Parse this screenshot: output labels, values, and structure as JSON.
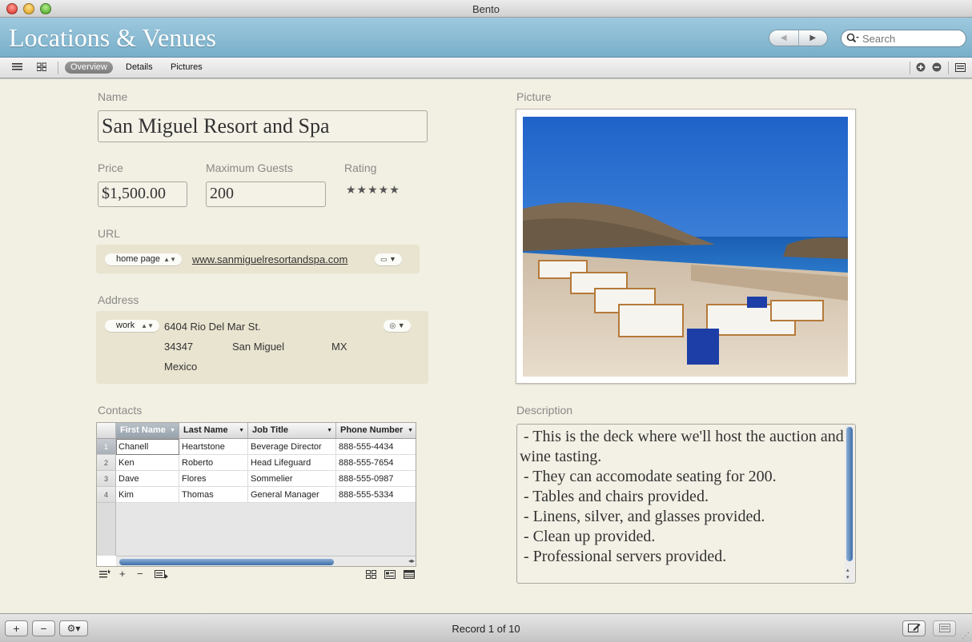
{
  "window": {
    "title": "Bento"
  },
  "header": {
    "library_title": "Locations & Venues",
    "back_icon": "◀",
    "forward_icon": "▶",
    "search_placeholder": "Search"
  },
  "toolbar": {
    "tabs": [
      "Overview",
      "Details",
      "Pictures"
    ],
    "active_tab": "Overview"
  },
  "form": {
    "name_label": "Name",
    "name_value": "San Miguel Resort and Spa",
    "price_label": "Price",
    "price_value": "$1,500.00",
    "guests_label": "Maximum Guests",
    "guests_value": "200",
    "rating_label": "Rating",
    "rating_value": 5,
    "rating_stars": "★★★★★",
    "url_label": "URL",
    "url_type": "home page",
    "url_value": "www.sanmiguelresortandspa.com",
    "address_label": "Address",
    "address_type": "work",
    "address_street": "6404 Rio Del Mar St.",
    "address_zip": "34347",
    "address_city": "San Miguel",
    "address_state": "MX",
    "address_country": "Mexico",
    "picture_label": "Picture",
    "contacts_label": "Contacts",
    "description_label": "Description",
    "description_text": " - This is the deck where we'll host the auction and wine tasting.\n - They can accomodate seating for 200.\n - Tables and chairs provided.\n - Linens, silver, and glasses provided.\n - Clean up provided.\n - Professional servers provided."
  },
  "contacts": {
    "columns": [
      "First Name",
      "Last Name",
      "Job Title",
      "Phone Number"
    ],
    "rows": [
      [
        "Chanell",
        "Heartstone",
        "Beverage Director",
        "888-555-4434"
      ],
      [
        "Ken",
        "Roberto",
        "Head Lifeguard",
        "888-555-7654"
      ],
      [
        "Dave",
        "Flores",
        "Sommelier",
        "888-555-0987"
      ],
      [
        "Kim",
        "Thomas",
        "General Manager",
        "888-555-5334"
      ]
    ],
    "row_numbers": [
      "1",
      "2",
      "3",
      "4"
    ]
  },
  "status": {
    "record_text": "Record 1 of 10"
  },
  "colors": {
    "header": "#8fbdd3",
    "content_bg": "#f2efe3",
    "selection": "#3d6ea8"
  }
}
